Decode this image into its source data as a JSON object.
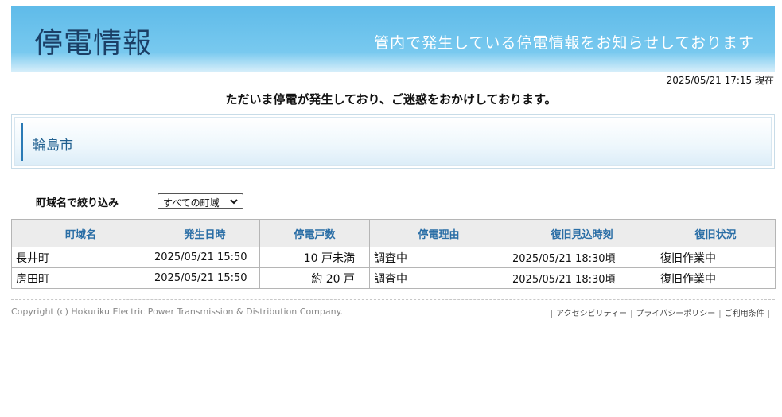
{
  "header": {
    "title": "停電情報",
    "tagline": "管内で発生している停電情報をお知らせしております"
  },
  "timestamp": "2025/05/21 17:15 現在",
  "notice": "ただいま停電が発生しており、ご迷惑をおかけしております。",
  "city": {
    "name": "輪島市"
  },
  "filter": {
    "label": "町域名で絞り込み",
    "selected": "すべての町域"
  },
  "table": {
    "headers": [
      "町域名",
      "発生日時",
      "停電戸数",
      "停電理由",
      "復旧見込時刻",
      "復旧状況"
    ],
    "rows": [
      [
        "長井町",
        "2025/05/21 15:50",
        "10 戸未満",
        "調査中",
        "2025/05/21 18:30頃",
        "復旧作業中"
      ],
      [
        "房田町",
        "2025/05/21 15:50",
        "約 20 戸",
        "調査中",
        "2025/05/21 18:30頃",
        "復旧作業中"
      ]
    ]
  },
  "footer": {
    "copyright": "Copyright (c) Hokuriku Electric Power Transmission & Distribution Company.",
    "links": [
      "アクセシビリティー",
      "プライバシーポリシー",
      "ご利用条件"
    ]
  },
  "colors": {
    "banner": "#6cc3ec",
    "title_text": "#1b3f66",
    "header_text": "#2a6ea6",
    "accent_bar": "#2a7ab5"
  }
}
